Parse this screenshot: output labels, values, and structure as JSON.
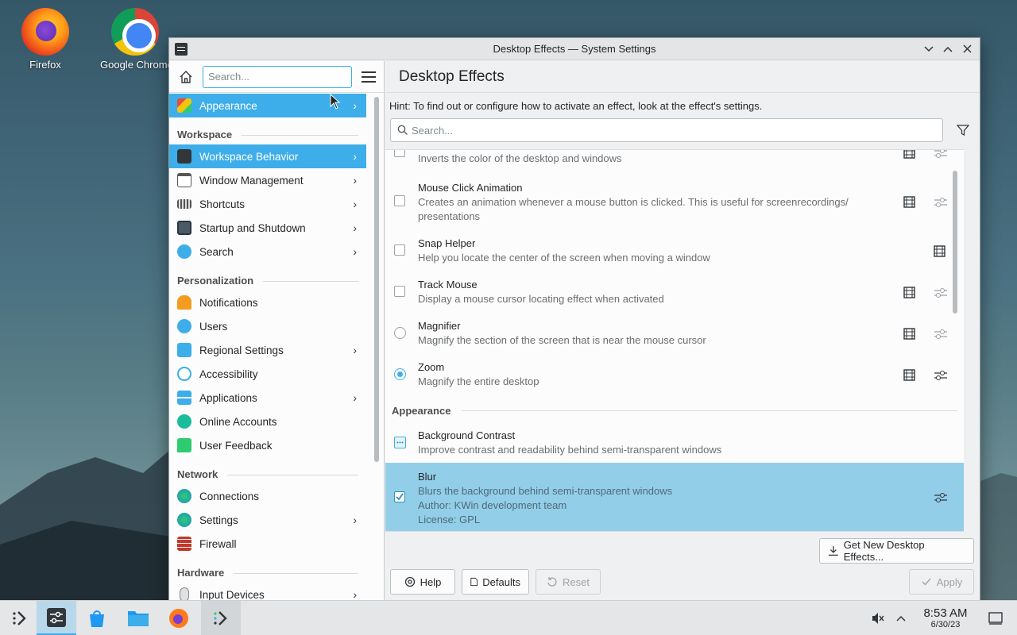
{
  "desktop": {
    "icons": [
      {
        "label": "Firefox",
        "icon": "firefox-icon"
      },
      {
        "label": "Google Chrome",
        "icon": "chrome-icon"
      }
    ]
  },
  "window": {
    "title": "Desktop Effects — System Settings",
    "controls": [
      "minimize",
      "maximize",
      "close"
    ]
  },
  "sidebar": {
    "search_placeholder": "Search...",
    "items": [
      {
        "label": "Appearance",
        "chevron": true,
        "selected": true
      },
      {
        "category": "Workspace"
      },
      {
        "label": "Workspace Behavior",
        "chevron": true,
        "selected": true
      },
      {
        "label": "Window Management",
        "chevron": true
      },
      {
        "label": "Shortcuts",
        "chevron": true
      },
      {
        "label": "Startup and Shutdown",
        "chevron": true
      },
      {
        "label": "Search",
        "chevron": true
      },
      {
        "category": "Personalization"
      },
      {
        "label": "Notifications",
        "chevron": false
      },
      {
        "label": "Users",
        "chevron": false
      },
      {
        "label": "Regional Settings",
        "chevron": true
      },
      {
        "label": "Accessibility",
        "chevron": false
      },
      {
        "label": "Applications",
        "chevron": true
      },
      {
        "label": "Online Accounts",
        "chevron": false
      },
      {
        "label": "User Feedback",
        "chevron": false
      },
      {
        "category": "Network"
      },
      {
        "label": "Connections",
        "chevron": false
      },
      {
        "label": "Settings",
        "chevron": true
      },
      {
        "label": "Firewall",
        "chevron": false
      },
      {
        "category": "Hardware"
      },
      {
        "label": "Input Devices",
        "chevron": true
      }
    ]
  },
  "main": {
    "title": "Desktop Effects",
    "hint": "Hint: To find out or configure how to activate an effect, look at the effect's settings.",
    "search_placeholder": "Search...",
    "effects": [
      {
        "name": "",
        "desc": "Inverts the color of the desktop and windows"
      },
      {
        "name": "Mouse Click Animation",
        "desc": "Creates an animation whenever a mouse button is clicked. This is useful for screenrecordings/ presentations"
      },
      {
        "name": "Snap Helper",
        "desc": "Help you locate the center of the screen when moving a window"
      },
      {
        "name": "Track Mouse",
        "desc": "Display a mouse cursor locating effect when activated"
      },
      {
        "name": "Magnifier",
        "desc": "Magnify the section of the screen that is near the mouse cursor"
      },
      {
        "name": "Zoom",
        "desc": "Magnify the entire desktop"
      },
      {
        "category": "Appearance"
      },
      {
        "name": "Background Contrast",
        "desc": "Improve contrast and readability behind semi-transparent windows"
      },
      {
        "name": "Blur",
        "desc": "Blurs the background behind semi-transparent windows",
        "author": "Author: KWin development team",
        "license": "License: GPL"
      }
    ],
    "get_new_label": "Get New Desktop Effects...",
    "help_label": "Help",
    "defaults_label": "Defaults",
    "reset_label": "Reset",
    "apply_label": "Apply"
  },
  "taskbar": {
    "clock_time": "8:53 AM",
    "clock_date": "6/30/23"
  },
  "colors": {
    "accent": "#3daee9",
    "selected_row": "#93cee9"
  }
}
